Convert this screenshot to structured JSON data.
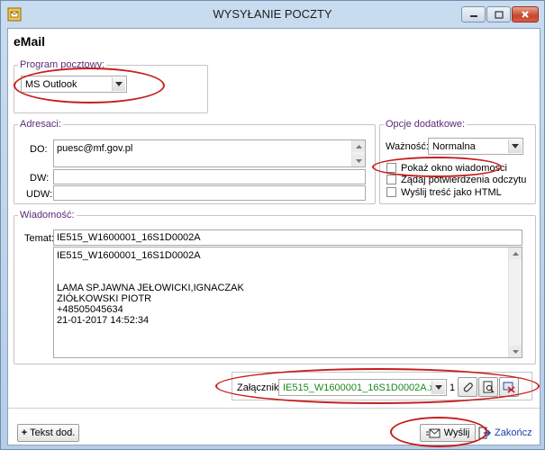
{
  "window": {
    "title": "WYSYŁANIE POCZTY",
    "heading": "eMail"
  },
  "program": {
    "legend": "Program pocztowy:",
    "selected": "MS Outlook"
  },
  "addresses": {
    "legend": "Adresaci:",
    "do_label": "DO:",
    "do_value": "puesc@mf.gov.pl",
    "dw_label": "DW:",
    "dw_value": "",
    "udw_label": "UDW:",
    "udw_value": ""
  },
  "options": {
    "legend": "Opcje dodatkowe:",
    "priority_label": "Ważność:",
    "priority_value": "Normalna",
    "show_window": "Pokaż okno wiadomości",
    "read_receipt": "Żądaj potwierdzenia odczytu",
    "send_html": "Wyślij treść jako HTML"
  },
  "message": {
    "legend": "Wiadomość:",
    "subject_label": "Temat:",
    "subject_value": "IE515_W1600001_16S1D0002A",
    "body_lines": [
      "IE515_W1600001_16S1D0002A",
      "",
      "",
      "LAMA SP.JAWNA JEŁOWICKI,IGNACZAK",
      "ZIÓŁKOWSKI PIOTR",
      "+48505045634",
      "21-01-2017 14:52:34"
    ]
  },
  "attachments": {
    "label": "Załączniki:",
    "selected": "IE515_W1600001_16S1D0002A.xml",
    "count": "1"
  },
  "buttons": {
    "extra_text": "Tekst dod.",
    "send": "Wyślij",
    "finish": "Zakończ"
  },
  "colors": {
    "annotation": "#c81e1e",
    "attachment_text": "#1a8a1a"
  }
}
